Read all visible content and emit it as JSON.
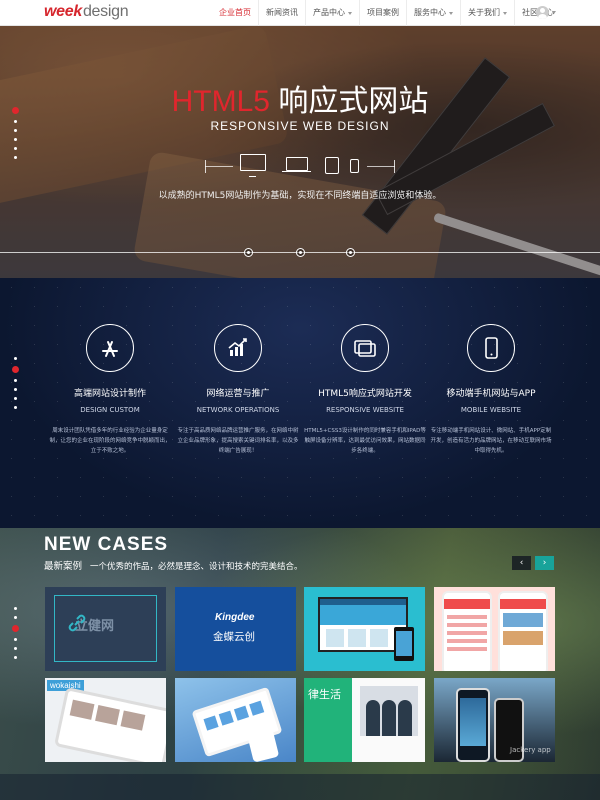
{
  "header": {
    "logo_main": "week",
    "logo_sub": "design",
    "nav": [
      {
        "label": "企业首页",
        "active": true
      },
      {
        "label": "新闻资讯"
      },
      {
        "label": "产品中心",
        "dropdown": true
      },
      {
        "label": "项目案例"
      },
      {
        "label": "服务中心",
        "dropdown": true
      },
      {
        "label": "关于我们",
        "dropdown": true
      },
      {
        "label": "社区中心"
      }
    ]
  },
  "hero": {
    "title_accent": "HTML5",
    "title_rest": "响应式网站",
    "subtitle": "RESPONSIVE WEB DESIGN",
    "description": "以成熟的HTML5网站制作为基础，实现在不同终端自适应浏览和体验。",
    "device_icons": [
      "monitor-icon",
      "laptop-icon",
      "tablet-icon",
      "phone-icon"
    ],
    "slider_dots": 3
  },
  "services": [
    {
      "icon": "app-store-icon",
      "title": "高端网站设计制作",
      "en": "DESIGN CUSTOM",
      "desc": "周末设计团队凭借多年的行业经验为企业量身定制，让您的企业在现阶段的网络竞争中脱颖而出，立于不败之地。"
    },
    {
      "icon": "chart-icon",
      "title": "网络运营与推广",
      "en": "NETWORK OPERATIONS",
      "desc": "专注于高品质网络品牌运营推广服务，在网络中树立企业品牌形象，提高搜索关键词排名率，以及多终端广告展现！"
    },
    {
      "icon": "windows-icon",
      "title": "HTML5响应式网站开发",
      "en": "RESPONSIVE WEBSITE",
      "desc": "HTML5+CSS3设计制作的同时兼容手机和IPAD等触屏设备分辨率，达到最优访问效果，网站数据同步各终端。"
    },
    {
      "icon": "mobile-icon",
      "title": "移动端手机网站与APP",
      "en": "MOBILE WEBSITE",
      "desc": "专注移动端手机网站设计、微网站、手机APP定制开发，创造有活力的品牌网站，在移动互联网市场中取得先机。"
    }
  ],
  "cases": {
    "title": "NEW CASES",
    "subtitle": "最新案例",
    "tagline": "一个优秀的作品，必然是理念、设计和技术的完美结合。",
    "prev": "‹",
    "next": "›",
    "thumbs": {
      "t1_text": "立健网",
      "t2_logo": "Kingdee",
      "t2_name": "金蝶云创",
      "t5_logo": "wokaishi",
      "t7_name": "律生活",
      "t8_label": "Jackery app"
    }
  },
  "colors": {
    "accent_red": "#e0262d",
    "teal": "#18a39a",
    "services_bg": "#0c1730"
  }
}
